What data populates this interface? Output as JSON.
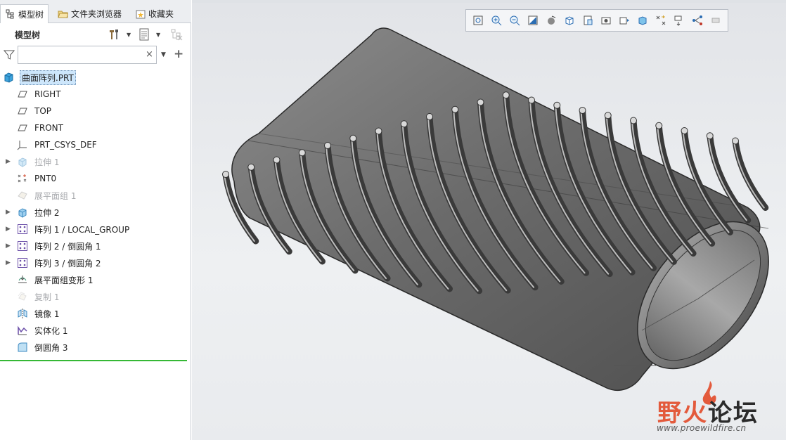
{
  "tabs": [
    {
      "label": "模型树",
      "icon": "model-tree-icon"
    },
    {
      "label": "文件夹浏览器",
      "icon": "folder-browser-icon"
    },
    {
      "label": "收藏夹",
      "icon": "favorites-icon"
    }
  ],
  "tree_toolbar": {
    "title": "模型树",
    "icons": [
      "tree-settings-icon",
      "tree-show-icon",
      "tree-filter-display-icon"
    ]
  },
  "search": {
    "value": "",
    "placeholder": ""
  },
  "tree": {
    "root": {
      "label": "曲面阵列.PRT",
      "icon": "part-icon"
    },
    "items": [
      {
        "label": "RIGHT",
        "icon": "datum-plane-icon",
        "expandable": false,
        "disabled": false
      },
      {
        "label": "TOP",
        "icon": "datum-plane-icon",
        "expandable": false,
        "disabled": false
      },
      {
        "label": "FRONT",
        "icon": "datum-plane-icon",
        "expandable": false,
        "disabled": false
      },
      {
        "label": "PRT_CSYS_DEF",
        "icon": "csys-icon",
        "expandable": false,
        "disabled": false
      },
      {
        "label": "拉伸 1",
        "icon": "extrude-icon",
        "expandable": true,
        "disabled": true
      },
      {
        "label": "PNT0",
        "icon": "datum-point-icon",
        "expandable": false,
        "disabled": false
      },
      {
        "label": "展平面组 1",
        "icon": "flatten-quilt-icon",
        "expandable": false,
        "disabled": true
      },
      {
        "label": "拉伸 2",
        "icon": "extrude-icon",
        "expandable": true,
        "disabled": false
      },
      {
        "label": "阵列 1 / LOCAL_GROUP",
        "icon": "pattern-icon",
        "expandable": true,
        "disabled": false
      },
      {
        "label": "阵列 2 / 倒圆角 1",
        "icon": "pattern-icon",
        "expandable": true,
        "disabled": false
      },
      {
        "label": "阵列 3 / 倒圆角 2",
        "icon": "pattern-icon",
        "expandable": true,
        "disabled": false
      },
      {
        "label": "展平面组变形 1",
        "icon": "flatten-deform-icon",
        "expandable": false,
        "disabled": false
      },
      {
        "label": "复制 1",
        "icon": "copy-icon",
        "expandable": false,
        "disabled": true
      },
      {
        "label": "镜像 1",
        "icon": "mirror-icon",
        "expandable": false,
        "disabled": false
      },
      {
        "label": "实体化 1",
        "icon": "solidify-icon",
        "expandable": false,
        "disabled": false
      },
      {
        "label": "倒圆角 3",
        "icon": "round-icon",
        "expandable": false,
        "disabled": false
      }
    ]
  },
  "view_toolbar": [
    "refit-icon",
    "zoom-in-icon",
    "zoom-out-icon",
    "repaint-icon",
    "display-style-icon",
    "saved-views-icon",
    "view-manager-icon",
    "perspective-icon",
    "spin-center-icon",
    "datum-display-icon",
    "annotation-display-icon",
    "plane-display-icon",
    "csys-display-icon",
    "section-icon"
  ],
  "watermark": {
    "brand_a": "野火",
    "brand_b": "论坛",
    "url": "www.proewildfire.cn"
  },
  "colors": {
    "selection": "#cde6fb",
    "insert_line": "#35b835",
    "brand_red": "#e35a3c",
    "model_gray": "#7a7a7a"
  }
}
